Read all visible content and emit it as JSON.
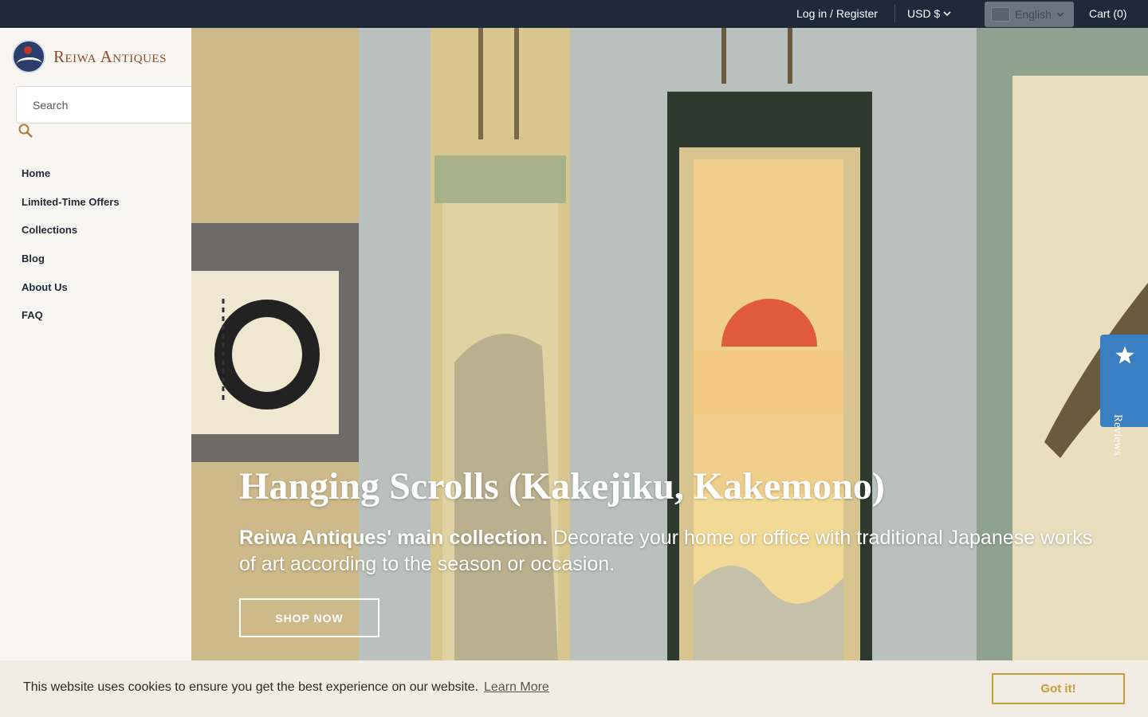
{
  "topbar": {
    "login_label": "Log in / Register",
    "currency_label": "USD $",
    "language_label": "English",
    "cart_label": "Cart (0)"
  },
  "brand": {
    "name": "Reiwa Antiques"
  },
  "search": {
    "placeholder": "Search"
  },
  "nav": {
    "items": [
      {
        "label": "Home"
      },
      {
        "label": "Limited-Time Offers"
      },
      {
        "label": "Collections"
      },
      {
        "label": "Blog"
      },
      {
        "label": "About Us"
      },
      {
        "label": "FAQ"
      }
    ]
  },
  "hero": {
    "title": "Hanging Scrolls (Kakejiku, Kakemono)",
    "lead_bold": "Reiwa Antiques' main collection.",
    "lead_text": " Decorate your home or office with traditional Japanese works of art according to the season or occasion.",
    "button_label": "SHOP NOW"
  },
  "reviews_tab": {
    "label": "Reviews"
  },
  "cookie": {
    "message": "This website uses cookies to ensure you get the best experience on our website.",
    "learn_more": "Learn More",
    "accept": "Got it!"
  },
  "colors": {
    "topbar_bg": "#1e2a3a",
    "brand_text": "#8b4a2b",
    "accent_gold": "#c89b3c",
    "reviews_blue": "#3a7fc1"
  }
}
